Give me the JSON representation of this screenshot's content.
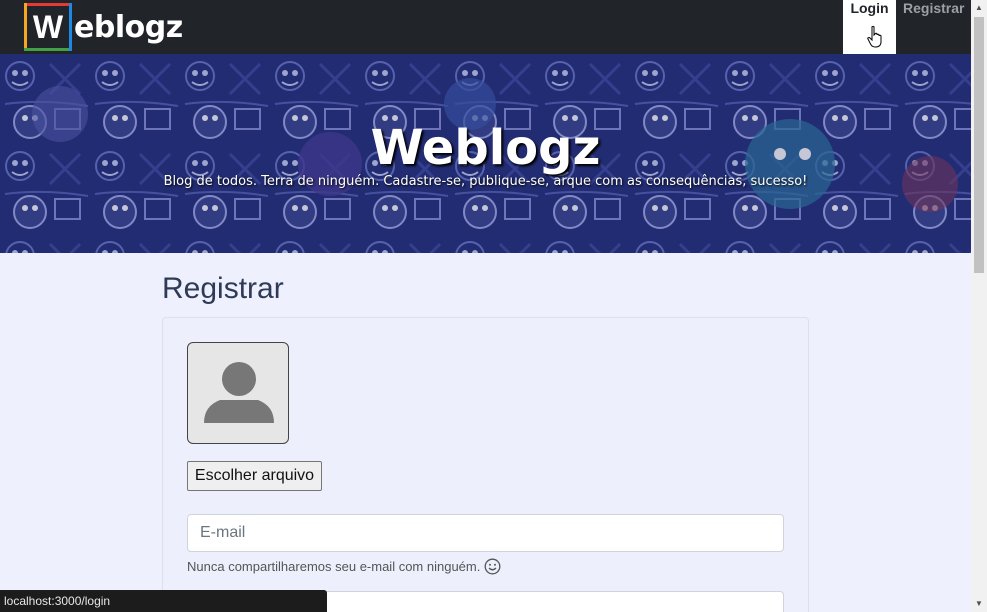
{
  "navbar": {
    "brand_letter": "W",
    "brand_text": "eblogz",
    "login_label": "Login",
    "register_label": "Registrar"
  },
  "hero": {
    "title": "Weblogz",
    "subtitle": "Blog de todos. Terra de ninguém. Cadastre-se, publique-se, arque com as consequências, sucesso!"
  },
  "main": {
    "page_title": "Registrar",
    "file_button_label": "Escolher arquivo",
    "email_placeholder": "E-mail",
    "email_help": "Nunca compartilharemos seu e-mail com ninguém."
  },
  "status_bar": {
    "url": "localhost:3000/login"
  },
  "colors": {
    "navbar_bg": "#212529",
    "hero_bg": "#25307a",
    "page_bg": "#eef1fd",
    "logo_red": "#e53935",
    "logo_orange": "#f5a623",
    "logo_green": "#43a047",
    "logo_blue": "#1e88e5"
  },
  "icons": [
    "user-placeholder-icon",
    "smiley-icon",
    "hand-pointer-cursor-icon",
    "scroll-up-arrow-icon",
    "scroll-down-arrow-icon"
  ]
}
